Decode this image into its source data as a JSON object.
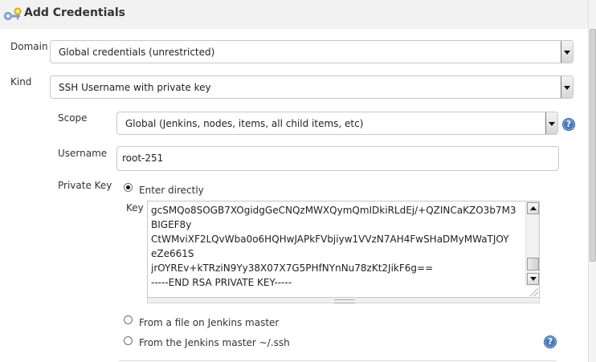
{
  "page": {
    "title": "Add Credentials",
    "icon": "credentials-keys-icon"
  },
  "form": {
    "domain": {
      "label": "Domain",
      "value": "Global credentials (unrestricted)"
    },
    "kind": {
      "label": "Kind",
      "value": "SSH Username with private key"
    },
    "scope": {
      "label": "Scope",
      "value": "Global (Jenkins, nodes, items, all child items, etc)"
    },
    "username": {
      "label": "Username",
      "value": "root-251"
    },
    "private_key": {
      "label": "Private Key",
      "options": [
        {
          "label": "Enter directly",
          "selected": true
        },
        {
          "label": "From a file on Jenkins master",
          "selected": false
        },
        {
          "label": "From the Jenkins master ~/.ssh",
          "selected": false
        }
      ],
      "key_label": "Key",
      "key_lines": [
        "gcSMQo8SOGB7XOgidgGeCNQzMWXQymQmIDkiRLdEj/+QZINCaKZO3b7M3",
        "BIGEF8y",
        "CtWMviXF2LQvWba0o6HQHwJAPkFVbjiyw1VVzN7AH4FwSHaDMyMWaTJOY",
        "eZe661S",
        "jrOYREv+kTRziN9Yy38X07X7G5PHfNYnNu78zKt2JikF6g==",
        "-----END RSA PRIVATE KEY-----"
      ]
    }
  },
  "help": {
    "glyph": "?"
  },
  "icons": {
    "help": "help-icon",
    "dropdown": "chevron-down-icon"
  },
  "colors": {
    "accent": "#4a78b8",
    "header_bg": "#f2f2f2"
  }
}
